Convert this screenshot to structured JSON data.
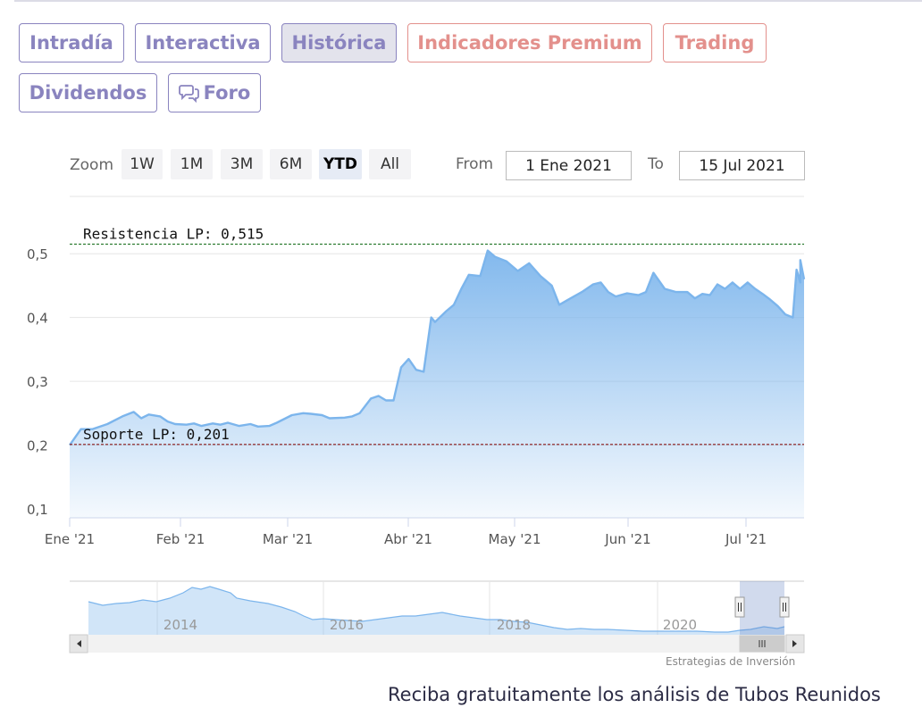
{
  "tabs": {
    "intradia": "Intradía",
    "interactiva": "Interactiva",
    "historica": "Histórica",
    "indicadores": "Indicadores Premium",
    "trading": "Trading",
    "dividendos": "Dividendos",
    "foro": "Foro"
  },
  "range_selector": {
    "zoom_label": "Zoom",
    "buttons": [
      "1W",
      "1M",
      "3M",
      "6M",
      "YTD",
      "All"
    ],
    "selected": "YTD",
    "from_label": "From",
    "from_value": "1 Ene 2021",
    "to_label": "To",
    "to_value": "15 Jul 2021"
  },
  "colors": {
    "tab_text": "#8a84bf",
    "premium_text": "#e3908c",
    "series_line": "#7cb5ec",
    "resistance_line": "#2e7d32",
    "support_line": "#8b1a1a"
  },
  "chart_data": {
    "type": "area",
    "title": "",
    "xlabel": "",
    "ylabel": "",
    "x_ticks": [
      "Ene '21",
      "Feb '21",
      "Mar '21",
      "Abr '21",
      "May '21",
      "Jun '21",
      "Jul '21"
    ],
    "y_ticks": [
      "0,1",
      "0,2",
      "0,3",
      "0,4",
      "0,5"
    ],
    "ylim": [
      0.1,
      0.5
    ],
    "xlim": [
      "2021-01-01",
      "2021-07-15"
    ],
    "grid": true,
    "series": [
      {
        "values": [
          [
            "2021-01-01",
            0.2
          ],
          [
            "2021-01-04",
            0.225
          ],
          [
            "2021-01-07",
            0.225
          ],
          [
            "2021-01-11",
            0.233
          ],
          [
            "2021-01-15",
            0.245
          ],
          [
            "2021-01-18",
            0.252
          ],
          [
            "2021-01-20",
            0.242
          ],
          [
            "2021-01-22",
            0.248
          ],
          [
            "2021-01-25",
            0.245
          ],
          [
            "2021-01-27",
            0.237
          ],
          [
            "2021-01-29",
            0.233
          ],
          [
            "2021-02-01",
            0.232
          ],
          [
            "2021-02-03",
            0.234
          ],
          [
            "2021-02-05",
            0.23
          ],
          [
            "2021-02-08",
            0.234
          ],
          [
            "2021-02-10",
            0.232
          ],
          [
            "2021-02-12",
            0.235
          ],
          [
            "2021-02-15",
            0.23
          ],
          [
            "2021-02-18",
            0.233
          ],
          [
            "2021-02-20",
            0.229
          ],
          [
            "2021-02-23",
            0.23
          ],
          [
            "2021-02-25",
            0.235
          ],
          [
            "2021-03-01",
            0.247
          ],
          [
            "2021-03-04",
            0.25
          ],
          [
            "2021-03-06",
            0.249
          ],
          [
            "2021-03-09",
            0.247
          ],
          [
            "2021-03-11",
            0.242
          ],
          [
            "2021-03-15",
            0.243
          ],
          [
            "2021-03-17",
            0.245
          ],
          [
            "2021-03-19",
            0.25
          ],
          [
            "2021-03-22",
            0.273
          ],
          [
            "2021-03-24",
            0.277
          ],
          [
            "2021-03-26",
            0.27
          ],
          [
            "2021-03-28",
            0.27
          ],
          [
            "2021-03-30",
            0.322
          ],
          [
            "2021-04-01",
            0.335
          ],
          [
            "2021-04-03",
            0.318
          ],
          [
            "2021-04-05",
            0.315
          ],
          [
            "2021-04-07",
            0.4
          ],
          [
            "2021-04-08",
            0.393
          ],
          [
            "2021-04-11",
            0.41
          ],
          [
            "2021-04-13",
            0.42
          ],
          [
            "2021-04-15",
            0.445
          ],
          [
            "2021-04-17",
            0.467
          ],
          [
            "2021-04-20",
            0.465
          ],
          [
            "2021-04-22",
            0.505
          ],
          [
            "2021-04-24",
            0.495
          ],
          [
            "2021-04-27",
            0.488
          ],
          [
            "2021-04-30",
            0.473
          ],
          [
            "2021-05-03",
            0.485
          ],
          [
            "2021-05-06",
            0.465
          ],
          [
            "2021-05-09",
            0.45
          ],
          [
            "2021-05-11",
            0.42
          ],
          [
            "2021-05-14",
            0.43
          ],
          [
            "2021-05-17",
            0.44
          ],
          [
            "2021-05-20",
            0.452
          ],
          [
            "2021-05-22",
            0.455
          ],
          [
            "2021-05-24",
            0.44
          ],
          [
            "2021-05-26",
            0.433
          ],
          [
            "2021-05-29",
            0.438
          ],
          [
            "2021-06-01",
            0.435
          ],
          [
            "2021-06-03",
            0.44
          ],
          [
            "2021-06-05",
            0.47
          ],
          [
            "2021-06-08",
            0.445
          ],
          [
            "2021-06-11",
            0.44
          ],
          [
            "2021-06-14",
            0.44
          ],
          [
            "2021-06-16",
            0.43
          ],
          [
            "2021-06-18",
            0.437
          ],
          [
            "2021-06-20",
            0.435
          ],
          [
            "2021-06-22",
            0.452
          ],
          [
            "2021-06-24",
            0.445
          ],
          [
            "2021-06-26",
            0.455
          ],
          [
            "2021-06-28",
            0.445
          ],
          [
            "2021-06-30",
            0.455
          ],
          [
            "2021-07-02",
            0.445
          ],
          [
            "2021-07-04",
            0.437
          ],
          [
            "2021-07-06",
            0.428
          ],
          [
            "2021-07-08",
            0.418
          ],
          [
            "2021-07-10",
            0.405
          ],
          [
            "2021-07-12",
            0.4
          ],
          [
            "2021-07-13",
            0.475
          ],
          [
            "2021-07-14",
            0.455
          ],
          [
            "2021-07-14",
            0.49
          ],
          [
            "2021-07-15",
            0.46
          ]
        ]
      }
    ],
    "annotations": [
      {
        "label": "Resistencia LP: 0,515",
        "value": 0.515
      },
      {
        "label": "Soporte LP: 0,201",
        "value": 0.201
      }
    ],
    "navigator": {
      "x_ticks": [
        "2014",
        "2016",
        "2018",
        "2020"
      ]
    }
  },
  "credit": "Estrategias de Inversión",
  "footer_text": "Reciba gratuitamente los análisis de Tubos Reunidos"
}
